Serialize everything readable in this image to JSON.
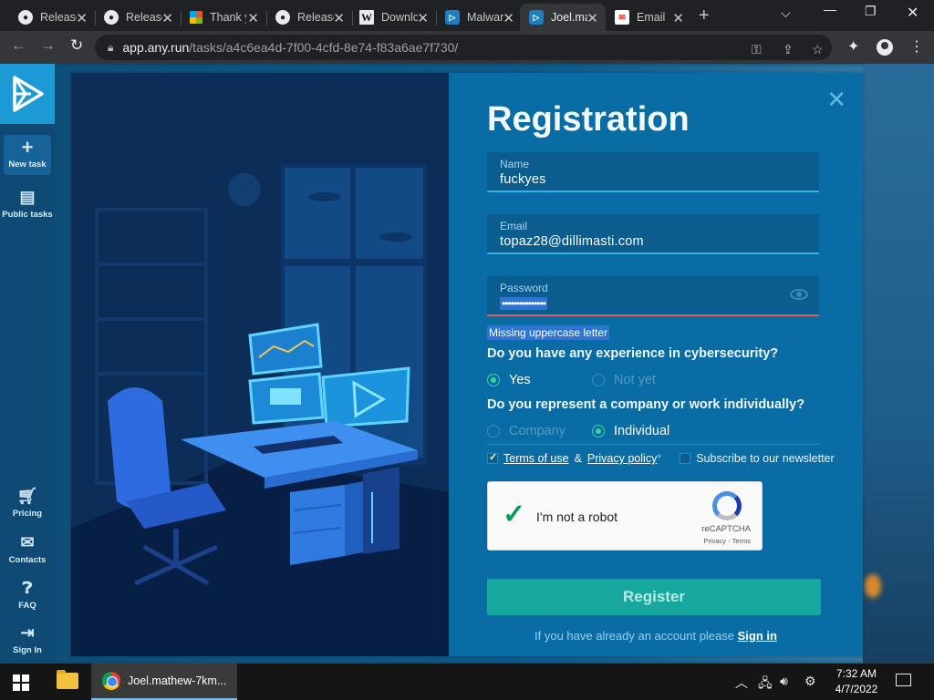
{
  "browser": {
    "tabs": [
      {
        "title": "Releases",
        "icon": "github-icon"
      },
      {
        "title": "Releases",
        "icon": "github-icon"
      },
      {
        "title": "Thank you",
        "icon": "microsoft-icon"
      },
      {
        "title": "Releases",
        "icon": "github-icon"
      },
      {
        "title": "Download",
        "icon": "w-icon"
      },
      {
        "title": "Malware",
        "icon": "anyrun-icon"
      },
      {
        "title": "Joel.mathew",
        "icon": "anyrun-icon",
        "active": true
      },
      {
        "title": "Email",
        "icon": "mail-icon"
      }
    ],
    "url_host": "app.any.run",
    "url_path": "/tasks/a4c6ea4d-7f00-4cfd-8e74-f83a6ae7f730/"
  },
  "sidebar": {
    "items": [
      {
        "label": "New task",
        "icon": "plus-icon"
      },
      {
        "label": "Public tasks",
        "icon": "document-icon"
      },
      {
        "label": "Pricing",
        "icon": "cart-icon"
      },
      {
        "label": "Contacts",
        "icon": "mail-icon"
      },
      {
        "label": "FAQ",
        "icon": "help-icon"
      },
      {
        "label": "Sign In",
        "icon": "signin-icon"
      }
    ]
  },
  "modal": {
    "title": "Registration",
    "name_label": "Name",
    "name_value": "fuckyes",
    "email_label": "Email",
    "email_value": "topaz28@dillimasti.com",
    "password_label": "Password",
    "password_value": "•••••••••••••••",
    "password_error": "Missing uppercase letter",
    "q1": "Do you have any experience in cybersecurity?",
    "q1_options": [
      "Yes",
      "Not yet"
    ],
    "q1_selected": "Yes",
    "q2": "Do you represent a company or work individually?",
    "q2_options": [
      "Company",
      "Individual"
    ],
    "q2_selected": "Individual",
    "terms_link": "Terms of use",
    "amp": "&",
    "privacy_link": "Privacy policy",
    "required_mark": "*",
    "newsletter": "Subscribe to our newsletter",
    "captcha_text": "I'm not a robot",
    "captcha_brand": "reCAPTCHA",
    "captcha_terms": "Privacy - Terms",
    "register_button": "Register",
    "signin_prompt": "If you have already an account please",
    "signin_link": "Sign in"
  },
  "taskbar": {
    "app_label": "Joel.mathew-7km...",
    "time": "7:32 AM",
    "date": "4/7/2022"
  },
  "colors": {
    "accent": "#17a79e",
    "modal_form": "#0a6ca4",
    "error": "#e0605f",
    "selected_radio": "#38d39f"
  }
}
